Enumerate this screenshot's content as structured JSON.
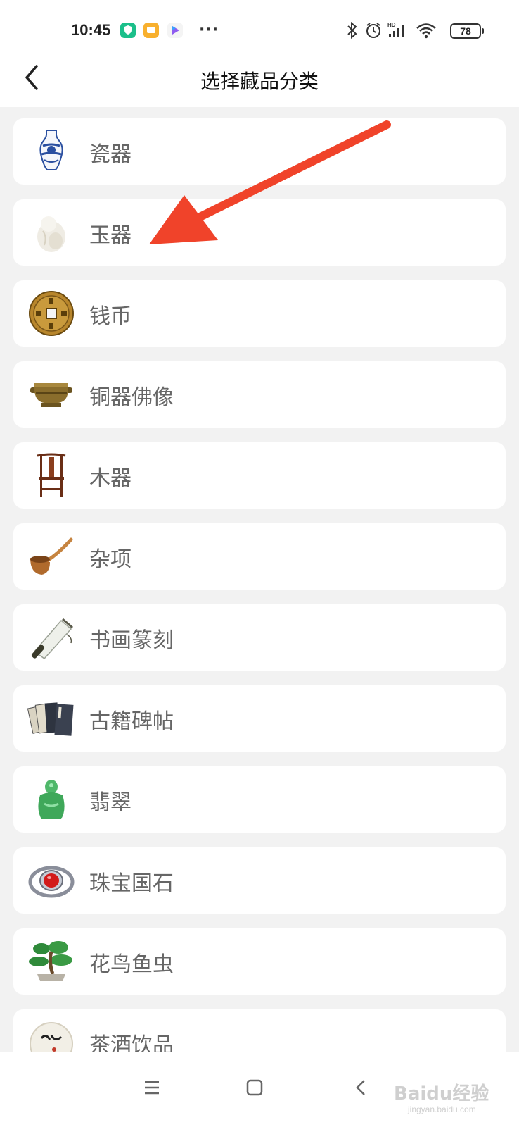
{
  "status_bar": {
    "time": "10:45",
    "dots": "···",
    "signal_label": "HD",
    "battery": "78",
    "icons": [
      "bluetooth-icon",
      "alarm-icon",
      "signal-icon",
      "wifi-icon"
    ]
  },
  "header": {
    "title": "选择藏品分类",
    "back_icon": "chevron-left-icon"
  },
  "categories": [
    {
      "label": "瓷器",
      "icon": "porcelain-vase-icon"
    },
    {
      "label": "玉器",
      "icon": "jade-carving-icon"
    },
    {
      "label": "钱币",
      "icon": "coin-icon"
    },
    {
      "label": "铜器佛像",
      "icon": "bronze-censer-icon"
    },
    {
      "label": "木器",
      "icon": "wooden-chair-icon"
    },
    {
      "label": "杂项",
      "icon": "pipe-icon"
    },
    {
      "label": "书画篆刻",
      "icon": "scroll-icon"
    },
    {
      "label": "古籍碑帖",
      "icon": "ancient-books-icon"
    },
    {
      "label": "翡翠",
      "icon": "jadeite-buddha-icon"
    },
    {
      "label": "珠宝国石",
      "icon": "ruby-ring-icon"
    },
    {
      "label": "花鸟鱼虫",
      "icon": "bonsai-icon"
    },
    {
      "label": "茶酒饮品",
      "icon": "tea-cake-icon"
    }
  ],
  "colors": {
    "annotation_arrow": "#f0432a",
    "background": "#f2f2f2",
    "card": "#ffffff",
    "label": "#666666"
  },
  "nav_bar": {
    "icons": [
      "menu-icon",
      "home-square-icon",
      "back-triangle-icon"
    ],
    "watermark": "Baidu经验",
    "watermark_sub": "jingyan.baidu.com"
  }
}
